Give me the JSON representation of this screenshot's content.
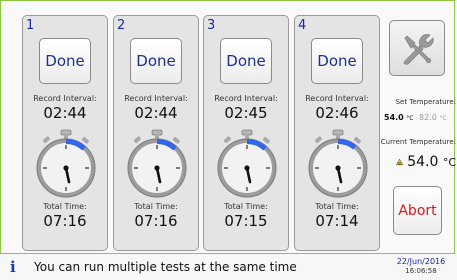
{
  "tests": [
    {
      "number": "1",
      "button": "Done",
      "record_label": "Record Interval:",
      "record_interval": "02:44",
      "total_label": "Total Time:",
      "total_time": "07:16",
      "progress": 0.12
    },
    {
      "number": "2",
      "button": "Done",
      "record_label": "Record Interval:",
      "record_interval": "02:44",
      "total_label": "Total Time:",
      "total_time": "07:16",
      "progress": 0.12
    },
    {
      "number": "3",
      "button": "Done",
      "record_label": "Record Interval:",
      "record_interval": "02:45",
      "total_label": "Total Time:",
      "total_time": "07:15",
      "progress": 0.12
    },
    {
      "number": "4",
      "button": "Done",
      "record_label": "Record Interval:",
      "record_interval": "02:46",
      "total_label": "Total Time:",
      "total_time": "07:14",
      "progress": 0.11
    }
  ],
  "side": {
    "set_label": "Set Temperature:",
    "set_actual": "54.0",
    "set_actual_unit": "°C",
    "set_target": "82.0",
    "set_target_unit": "°C",
    "current_label": "Current Temperature:",
    "current_value": "54.0",
    "current_unit": "°C",
    "abort_label": "Abort"
  },
  "icons": {
    "tools": "wrench-screwdriver-icon",
    "heater": "hot-surface-warning-icon",
    "info": "info-icon",
    "watch": "stopwatch-icon"
  },
  "status": {
    "message": "You can run multiple tests at the same time",
    "date": "22/Jun/2016",
    "time": "16:06:58"
  },
  "colors": {
    "frame": "#8dc63f",
    "accent": "#3366ee",
    "abort": "#d61a1a",
    "label": "#1a2a9a"
  }
}
